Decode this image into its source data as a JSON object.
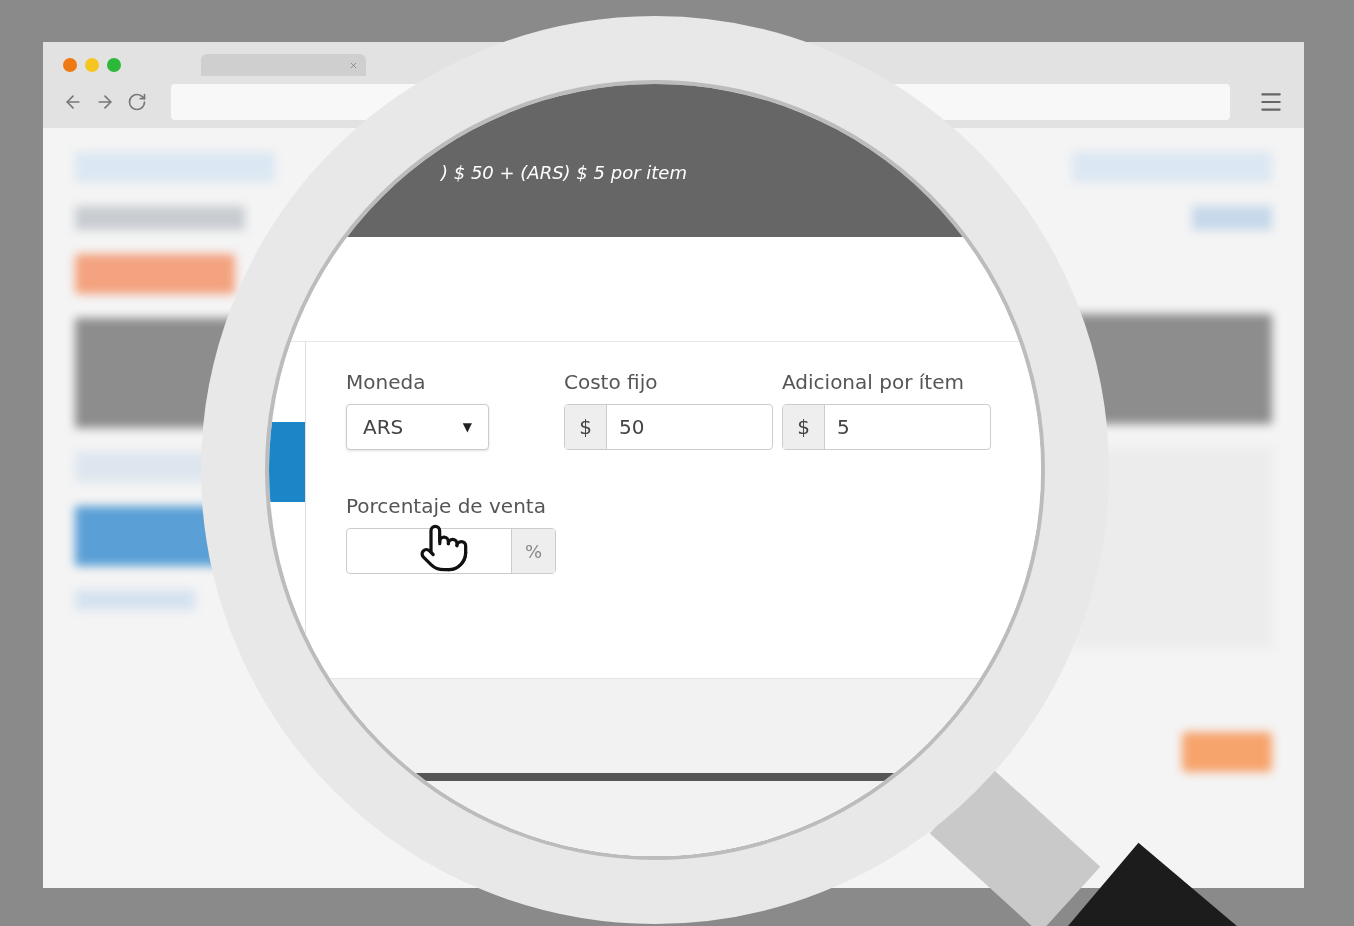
{
  "lens": {
    "header_text": ") $ 50 + (ARS) $ 5 por item",
    "fields": [
      {
        "kind": "select",
        "label": "Moneda",
        "value": "ARS",
        "caret": "▼"
      },
      {
        "kind": "prefix",
        "label": "Costo fijo",
        "addon": "$",
        "value": "50"
      },
      {
        "kind": "prefix",
        "label": "Adicional por ítem",
        "addon": "$",
        "value": "5"
      },
      {
        "kind": "suffix",
        "label": "Porcentaje de venta",
        "addon": "%"
      }
    ]
  }
}
